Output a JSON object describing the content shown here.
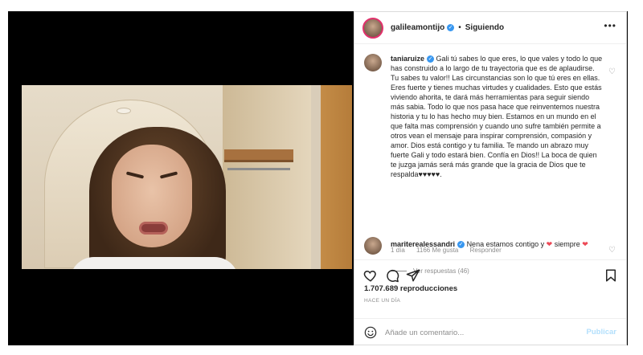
{
  "post": {
    "username": "galileamontijo",
    "separator": "•",
    "follow_status": "Siguiendo",
    "more_icon": "more-options-icon"
  },
  "comment": {
    "username": "taniaruize",
    "text": "Gali tú sabes lo que eres, lo que vales y todo lo que has construido a lo largo de tu trayectoria que es de aplaudirse. Tu sabes tu valor!! Las circunstancias son lo que tú eres en ellas. Eres fuerte y tienes muchas virtudes y cualidades. Esto que estás viviendo ahorita, te dará más herramientas para seguir siendo más sabia. Todo lo que nos pasa hace que reinventemos nuestra historia y tu lo has hecho muy bien. Estamos en un mundo en el que falta mas comprensión y cuando uno sufre también permite a otros vean el mensaje para inspirar comprensión, compasión y amor. Dios está contigo y tu familia. Te mando un abrazo muy fuerte Gali y todo estará bien. Confía en Dios!! La boca de quien te juzga jamás será más grande que la gracia de Dios que te respalda♥♥♥♥♥.",
    "time": "1 día",
    "likes": "1166 Me gusta",
    "reply": "Responder",
    "view_replies": "Ver respuestas (46)"
  },
  "comment2": {
    "username": "mariterealessandri",
    "text_before": "Nena estamos contigo y",
    "text_middle": "siempre",
    "heart": "❤"
  },
  "stats": {
    "views": "1.707.689 reproducciones",
    "ago": "HACE UN DÍA"
  },
  "add_comment": {
    "placeholder": "Añade un comentario...",
    "publish": "Publicar"
  },
  "colors": {
    "verified": "#3897f0",
    "heart_red": "#ed4956",
    "publish_disabled": "#b2dffc",
    "secondary_text": "#8e8e8e"
  }
}
